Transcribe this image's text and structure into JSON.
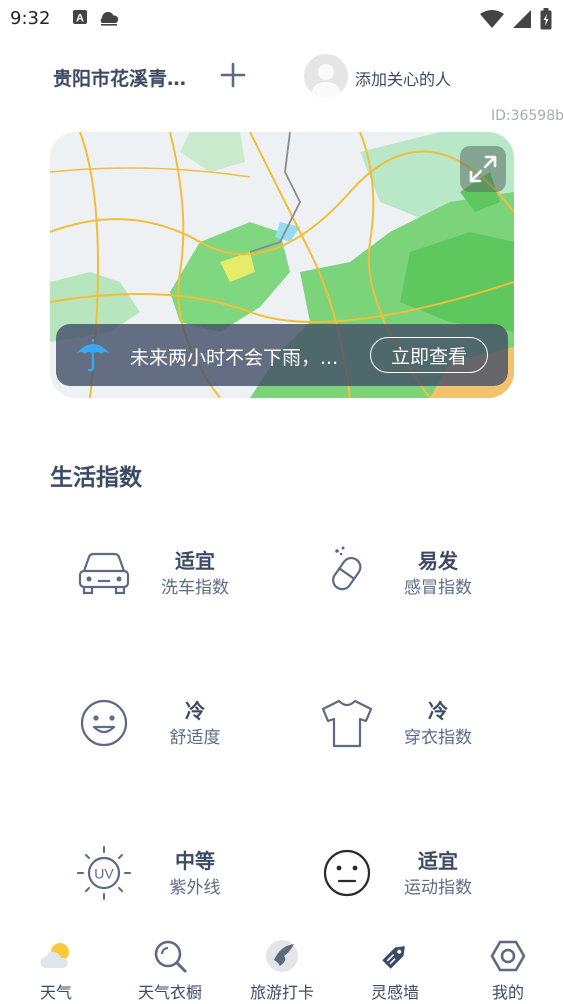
{
  "status": {
    "time": "9:32"
  },
  "header": {
    "location": "贵阳市花溪青…",
    "care_label": "添加关心的人",
    "user_id": "ID:36598b"
  },
  "rain": {
    "text": "未来两小时不会下雨，...",
    "button": "立即查看"
  },
  "life_index": {
    "title": "生活指数",
    "items": [
      {
        "level": "适宜",
        "name": "洗车指数",
        "icon": "car-icon"
      },
      {
        "level": "易发",
        "name": "感冒指数",
        "icon": "pill-icon"
      },
      {
        "level": "冷",
        "name": "舒适度",
        "icon": "smile-face-icon"
      },
      {
        "level": "冷",
        "name": "穿衣指数",
        "icon": "tshirt-icon"
      },
      {
        "level": "中等",
        "name": "紫外线",
        "icon": "uv-icon"
      },
      {
        "level": "适宜",
        "name": "运动指数",
        "icon": "neutral-face-icon"
      }
    ]
  },
  "tabs": [
    {
      "label": "天气",
      "icon": "weather-icon"
    },
    {
      "label": "天气衣橱",
      "icon": "wardrobe-icon"
    },
    {
      "label": "旅游打卡",
      "icon": "travel-icon"
    },
    {
      "label": "灵感墙",
      "icon": "tag-icon"
    },
    {
      "label": "我的",
      "icon": "profile-hexagon-icon"
    }
  ]
}
